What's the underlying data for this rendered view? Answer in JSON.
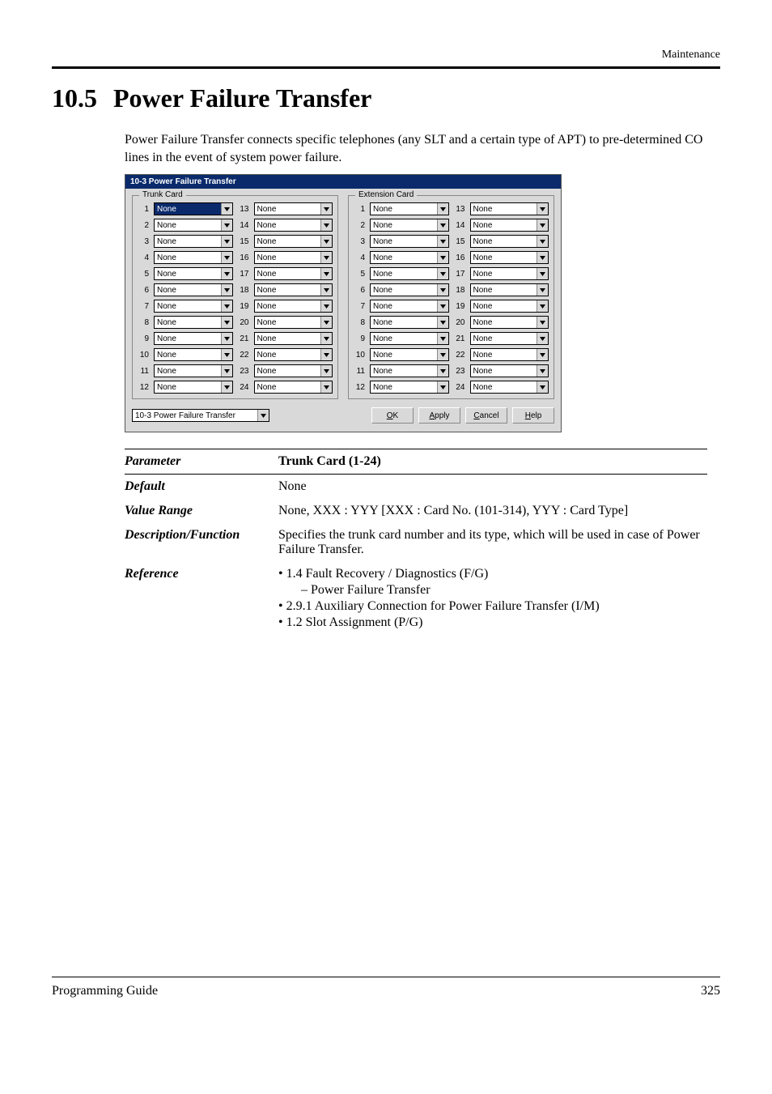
{
  "header": {
    "label": "Maintenance"
  },
  "section": {
    "number": "10.5",
    "title": "Power Failure Transfer",
    "intro": "Power Failure Transfer connects specific telephones (any SLT and a certain type of APT) to pre-determined CO lines in the event of system power failure."
  },
  "dialog": {
    "title": "10-3 Power Failure Transfer",
    "trunk_legend": "Trunk Card",
    "ext_legend": "Extension Card",
    "trunk": [
      {
        "n": "1",
        "v": "None"
      },
      {
        "n": "2",
        "v": "None"
      },
      {
        "n": "3",
        "v": "None"
      },
      {
        "n": "4",
        "v": "None"
      },
      {
        "n": "5",
        "v": "None"
      },
      {
        "n": "6",
        "v": "None"
      },
      {
        "n": "7",
        "v": "None"
      },
      {
        "n": "8",
        "v": "None"
      },
      {
        "n": "9",
        "v": "None"
      },
      {
        "n": "10",
        "v": "None"
      },
      {
        "n": "11",
        "v": "None"
      },
      {
        "n": "12",
        "v": "None"
      },
      {
        "n": "13",
        "v": "None"
      },
      {
        "n": "14",
        "v": "None"
      },
      {
        "n": "15",
        "v": "None"
      },
      {
        "n": "16",
        "v": "None"
      },
      {
        "n": "17",
        "v": "None"
      },
      {
        "n": "18",
        "v": "None"
      },
      {
        "n": "19",
        "v": "None"
      },
      {
        "n": "20",
        "v": "None"
      },
      {
        "n": "21",
        "v": "None"
      },
      {
        "n": "22",
        "v": "None"
      },
      {
        "n": "23",
        "v": "None"
      },
      {
        "n": "24",
        "v": "None"
      }
    ],
    "ext": [
      {
        "n": "1",
        "v": "None"
      },
      {
        "n": "2",
        "v": "None"
      },
      {
        "n": "3",
        "v": "None"
      },
      {
        "n": "4",
        "v": "None"
      },
      {
        "n": "5",
        "v": "None"
      },
      {
        "n": "6",
        "v": "None"
      },
      {
        "n": "7",
        "v": "None"
      },
      {
        "n": "8",
        "v": "None"
      },
      {
        "n": "9",
        "v": "None"
      },
      {
        "n": "10",
        "v": "None"
      },
      {
        "n": "11",
        "v": "None"
      },
      {
        "n": "12",
        "v": "None"
      },
      {
        "n": "13",
        "v": "None"
      },
      {
        "n": "14",
        "v": "None"
      },
      {
        "n": "15",
        "v": "None"
      },
      {
        "n": "16",
        "v": "None"
      },
      {
        "n": "17",
        "v": "None"
      },
      {
        "n": "18",
        "v": "None"
      },
      {
        "n": "19",
        "v": "None"
      },
      {
        "n": "20",
        "v": "None"
      },
      {
        "n": "21",
        "v": "None"
      },
      {
        "n": "22",
        "v": "None"
      },
      {
        "n": "23",
        "v": "None"
      },
      {
        "n": "24",
        "v": "None"
      }
    ],
    "page_selector": "10-3 Power Failure Transfer",
    "buttons": {
      "ok": "OK",
      "apply": "Apply",
      "cancel": "Cancel",
      "help": "Help"
    }
  },
  "param": {
    "parameter_label": "Parameter",
    "parameter_value": "Trunk Card (1-24)",
    "default_label": "Default",
    "default_value": "None",
    "value_range_label": "Value Range",
    "value_range_value": "None, XXX : YYY [XXX : Card No. (101-314), YYY : Card Type]",
    "desc_label": "Description/Function",
    "desc_value": "Specifies the trunk card number and its type, which will be used in case of Power Failure Transfer.",
    "ref_label": "Reference",
    "ref": {
      "r1": "• 1.4 Fault Recovery / Diagnostics (F/G)",
      "r1sub": "– Power Failure Transfer",
      "r2": "• 2.9.1 Auxiliary Connection for Power Failure Transfer (I/M)",
      "r3": "• 1.2 Slot Assignment (P/G)"
    }
  },
  "footer": {
    "left": "Programming Guide",
    "right": "325"
  }
}
